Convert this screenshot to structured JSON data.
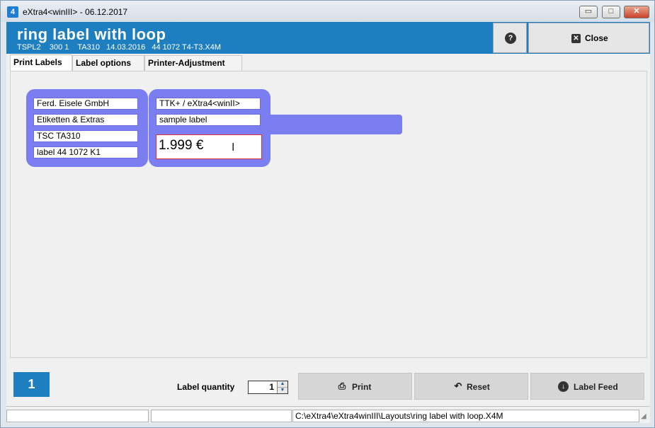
{
  "window": {
    "title": "eXtra4<winIII> - 06.12.2017",
    "app_icon_text": "4",
    "controls": {
      "minimize": "▭",
      "maximize": "□",
      "close": "✕"
    }
  },
  "header": {
    "title": "ring label with loop",
    "subtitle": "TSPL2    300 1    TA310   14.03.2016   44 1072 T4-T3.X4M",
    "help_icon": "?",
    "close_icon": "✕",
    "close_label": "Close"
  },
  "tabs": [
    {
      "label": "Print Labels",
      "active": true
    },
    {
      "label": "Label options",
      "active": false
    },
    {
      "label": "Printer-Adjustment",
      "active": false
    }
  ],
  "label": {
    "left_fields": [
      "Ferd. Eisele GmbH",
      "Etiketten & Extras",
      "TSC TA310",
      "label 44 1072 K1"
    ],
    "right_fields": [
      "TTK+ / eXtra4<winII>",
      "sample label"
    ],
    "price": "1.999 €",
    "shape_color": "#7b7ef0",
    "price_border_color": "#e03030"
  },
  "bottom": {
    "counter": "1",
    "qty_label": "Label quantity",
    "qty_value": "1",
    "print_icon": "⎙",
    "print_label": "Print",
    "reset_icon": "↶",
    "reset_label": "Reset",
    "feed_icon": "↓",
    "feed_label": "Label Feed"
  },
  "statusbar": {
    "cell1": "",
    "cell2": "",
    "path": "C:\\eXtra4\\eXtra4winIII\\Layouts\\ring label with loop.X4M"
  },
  "colors": {
    "accent": "#1e7fc0",
    "background": "#f0f0f0"
  }
}
